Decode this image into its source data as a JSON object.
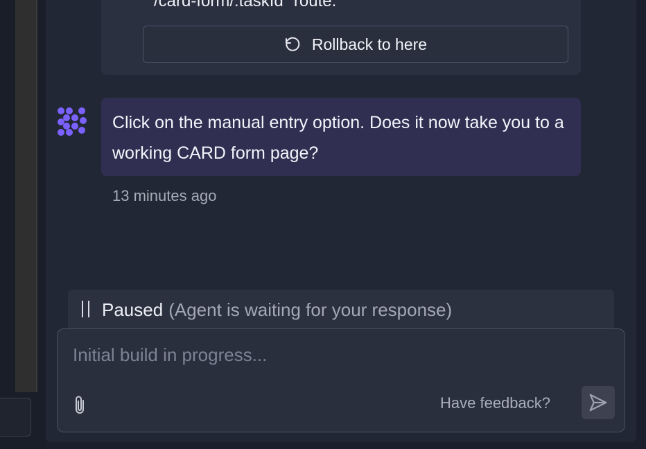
{
  "previous_message": {
    "text_fragment": "/card-form/:taskId\" route.",
    "rollback_label": "Rollback to here"
  },
  "message": {
    "text": "Click on the manual entry option. Does it now take you to a working CARD form page?",
    "timestamp": "13 minutes ago"
  },
  "status": {
    "title": "Paused",
    "detail": "(Agent is waiting for your response)"
  },
  "composer": {
    "placeholder": "Initial build in progress...",
    "feedback_label": "Have feedback?"
  },
  "colors": {
    "accent": "#7b61ff",
    "bubble": "#302f52",
    "panel": "#222735"
  },
  "icons": {
    "rollback": "rotate-ccw-icon",
    "agent": "agent-logo-icon",
    "pause": "pause-icon",
    "attach": "paperclip-icon",
    "send": "send-icon"
  }
}
